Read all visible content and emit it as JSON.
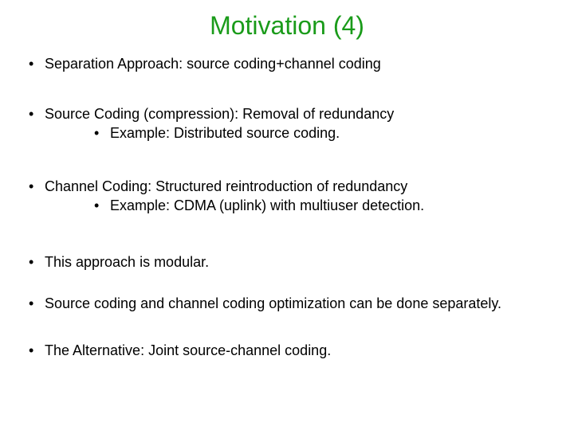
{
  "title": "Motivation (4)",
  "bullets": [
    {
      "text": "Separation Approach: source coding+channel coding",
      "sub": []
    },
    {
      "text": "Source Coding (compression): Removal of redundancy",
      "sub": [
        "Example: Distributed source coding."
      ]
    },
    {
      "text": "Channel Coding: Structured reintroduction of redundancy",
      "sub": [
        "Example: CDMA (uplink) with multiuser detection."
      ]
    },
    {
      "text": "This approach is modular.",
      "sub": []
    },
    {
      "text": "Source coding and channel coding optimization can be done separately.",
      "sub": []
    },
    {
      "text": "The Alternative: Joint source-channel coding.",
      "sub": []
    }
  ]
}
